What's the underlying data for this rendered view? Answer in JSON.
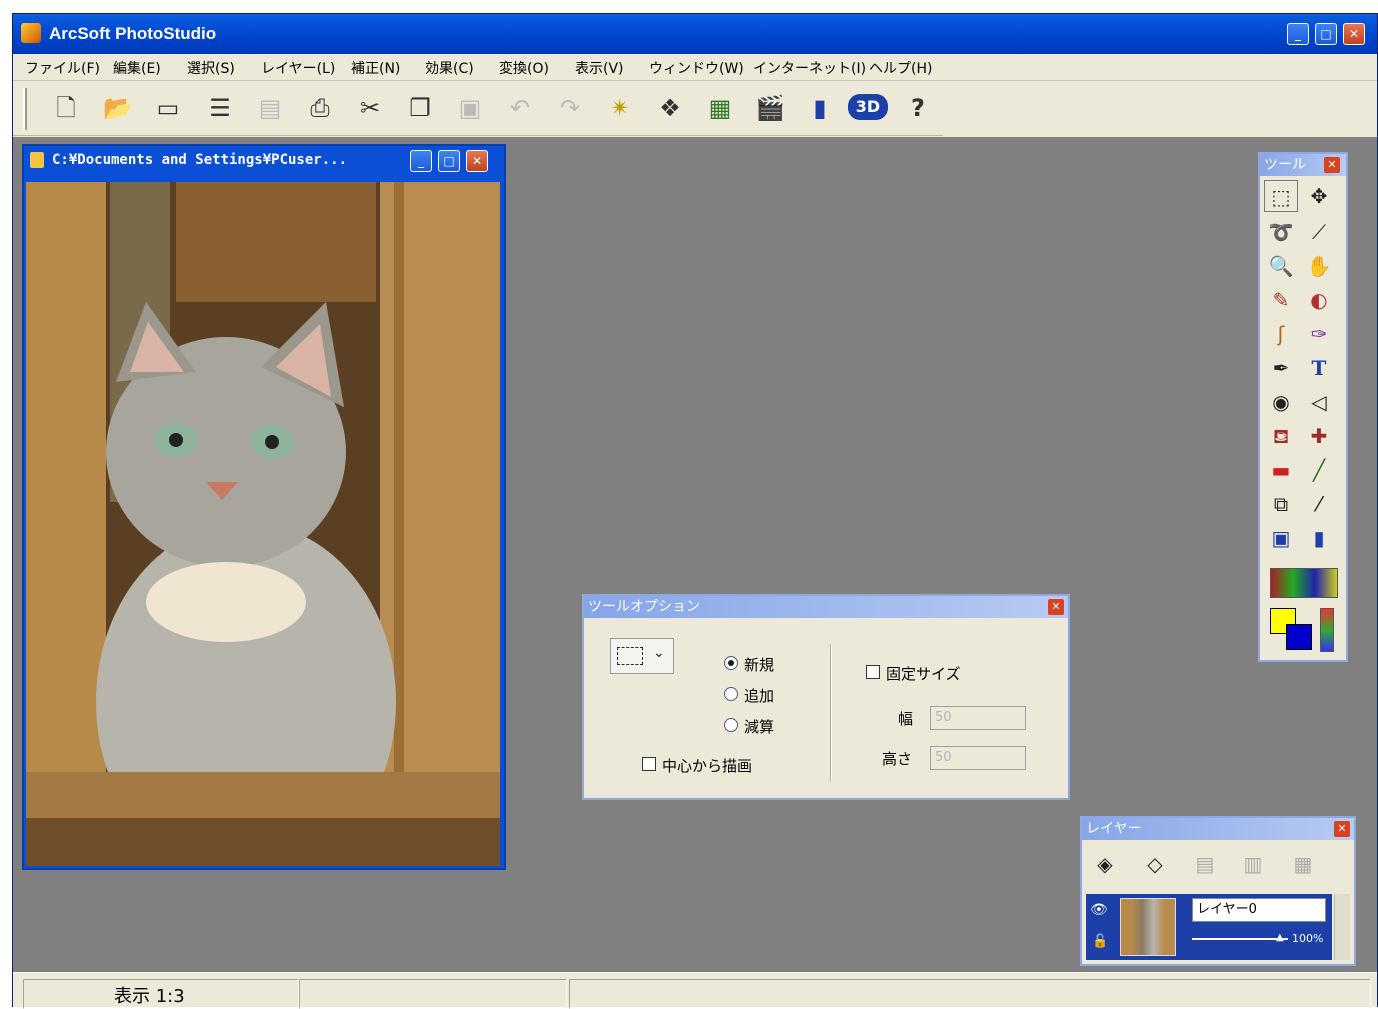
{
  "app": {
    "title": "ArcSoft PhotoStudio",
    "menu": [
      "ファイル(F)",
      "編集(E)",
      "選択(S)",
      "レイヤー(L)",
      "補正(N)",
      "効果(C)",
      "変換(O)",
      "表示(V)",
      "ウィンドウ(W)",
      "インターネット(I)",
      "ヘルプ(H)"
    ],
    "toolbar_icons": [
      "new-icon",
      "open-icon",
      "acquire-icon",
      "scanner-icon",
      "save-icon",
      "print-icon",
      "crop-icon",
      "duplicate-icon",
      "paste-icon",
      "undo-icon",
      "redo-icon",
      "enhance-icon",
      "effects-icon",
      "templates-icon",
      "slideshow-icon",
      "album-icon",
      "3d-icon",
      "help-icon"
    ],
    "toolbar_3d_label": "3D",
    "toolbar_help_label": "?"
  },
  "image_window": {
    "title": "C:¥Documents and Settings¥PCuser..."
  },
  "tool_panel": {
    "title": "ツール",
    "tools": [
      "rect-select-icon",
      "move-icon",
      "lasso-icon",
      "magic-wand-icon",
      "zoom-icon",
      "hand-icon",
      "red-eye-icon",
      "clone-icon",
      "smudge-icon",
      "brush-icon",
      "pen-icon",
      "text-icon",
      "sharpen-icon",
      "eraser-icon",
      "bucket-icon",
      "pipette-icon",
      "gradient-icon",
      "line-icon",
      "transform-icon",
      "dropper-icon",
      "layer-icon",
      "trash-icon"
    ],
    "text_tool_label": "T",
    "fg_color": "#ffff00",
    "bg_color": "#0000cc"
  },
  "tool_options": {
    "title": "ツールオプション",
    "modes": [
      "新規",
      "追加",
      "減算"
    ],
    "selected_mode": "新規",
    "draw_from_center": "中心から描画",
    "fixed_size": "固定サイズ",
    "width_label": "幅",
    "height_label": "高さ",
    "width_value": "50",
    "height_value": "50"
  },
  "layers_panel": {
    "title": "レイヤー",
    "layer_name": "レイヤー0",
    "opacity": "100%"
  },
  "status": {
    "zoom": "表示 1:3"
  }
}
